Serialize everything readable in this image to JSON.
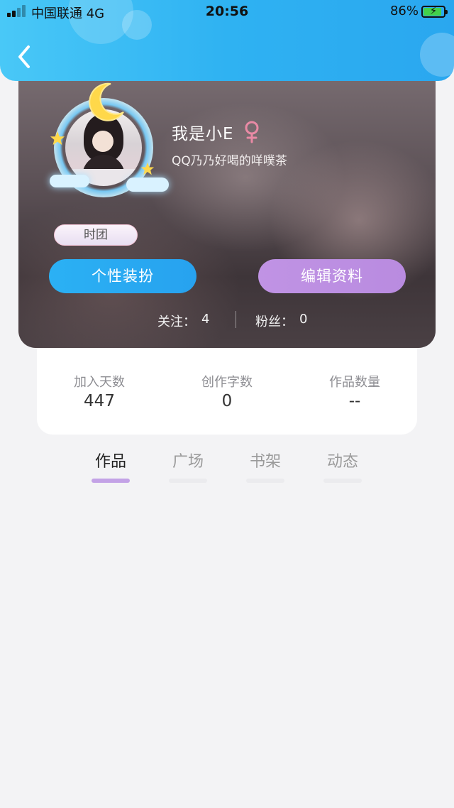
{
  "status_bar": {
    "carrier": "中国联通  4G",
    "time": "20:56",
    "battery": "86%"
  },
  "header": {
    "back_icon": "chevron-left-icon"
  },
  "profile": {
    "username": "我是小E",
    "gender_icon": "female-icon",
    "signature": "QQ乃乃好喝的咩噗茶",
    "team_badge": "时团",
    "dressup_button": "个性装扮",
    "edit_button": "编辑资料",
    "follow_label": "关注：",
    "follow_count": "4",
    "fans_label": "粉丝：",
    "fans_count": "0"
  },
  "stats": [
    {
      "label": "加入天数",
      "value": "447"
    },
    {
      "label": "创作字数",
      "value": "0"
    },
    {
      "label": "作品数量",
      "value": "--"
    }
  ],
  "tabs": [
    {
      "label": "作品",
      "active": true
    },
    {
      "label": "广场",
      "active": false
    },
    {
      "label": "书架",
      "active": false
    },
    {
      "label": "动态",
      "active": false
    }
  ],
  "colors": {
    "header": "#2fb2f2",
    "dressup_button": "#27a8f2",
    "edit_button": "#bd8fe2",
    "active_tab_indicator": "#c3a2e6",
    "page_background": "#f3f3f5"
  }
}
